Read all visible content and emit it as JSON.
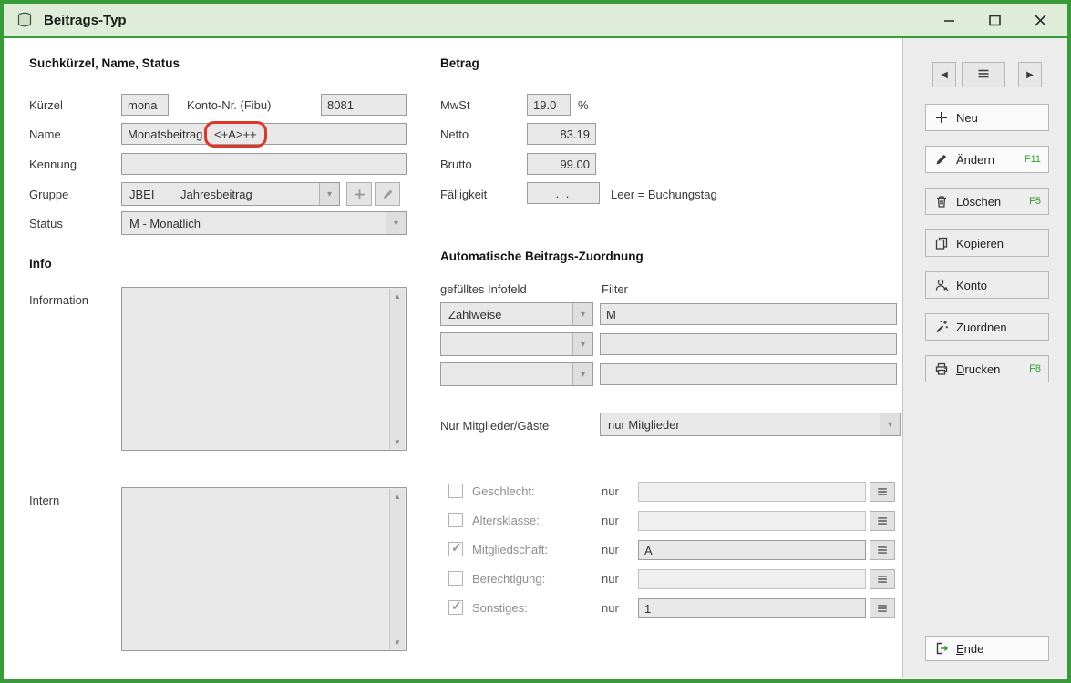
{
  "titlebar": {
    "title": "Beitrags-Typ",
    "icon": "coins-stack",
    "controls": {
      "minimize": "minimize",
      "maximize": "maximize",
      "close": "close"
    }
  },
  "form": {
    "section_title": "Suchkürzel, Name, Status",
    "kuerzel": {
      "label": "Kürzel",
      "value": "mona"
    },
    "konto_nr": {
      "label": "Konto-Nr. (Fibu)",
      "value": "8081"
    },
    "name": {
      "label": "Name",
      "value_prefix": "Monatsbeitrag ",
      "value_highlight": "<+A>++"
    },
    "kennung": {
      "label": "Kennung",
      "value": ""
    },
    "gruppe": {
      "label": "Gruppe",
      "code": "JBEI",
      "text": "Jahresbeitrag"
    },
    "status": {
      "label": "Status",
      "value": "M - Monatlich"
    },
    "info_title": "Info",
    "information": {
      "label": "Information",
      "value": ""
    },
    "intern": {
      "label": "Intern",
      "value": ""
    }
  },
  "betrag": {
    "section_title": "Betrag",
    "mwst": {
      "label": "MwSt",
      "value": "19.0",
      "unit": "%"
    },
    "netto": {
      "label": "Netto",
      "value": "83.19"
    },
    "brutto": {
      "label": "Brutto",
      "value": "99.00"
    },
    "faelligkeit": {
      "label": "Fälligkeit",
      "value": ". .",
      "hint": "Leer = Buchungstag"
    }
  },
  "zuordnung": {
    "section_title": "Automatische Beitrags-Zuordnung",
    "col_infofeld": "gefülltes Infofeld",
    "col_filter": "Filter",
    "rows": [
      {
        "field": "Zahlweise",
        "filter": "M"
      },
      {
        "field": "",
        "filter": ""
      },
      {
        "field": "",
        "filter": ""
      }
    ],
    "mitglieder": {
      "label": "Nur Mitglieder/Gäste",
      "value": "nur Mitglieder"
    },
    "criteria": [
      {
        "checked": false,
        "label": "Geschlecht:",
        "nur": "nur",
        "value": ""
      },
      {
        "checked": false,
        "label": "Altersklasse:",
        "nur": "nur",
        "value": ""
      },
      {
        "checked": true,
        "label": "Mitgliedschaft:",
        "nur": "nur",
        "value": "A"
      },
      {
        "checked": false,
        "label": "Berechtigung:",
        "nur": "nur",
        "value": ""
      },
      {
        "checked": true,
        "label": "Sonstiges:",
        "nur": "nur",
        "value": "1"
      }
    ]
  },
  "sidebar": {
    "nav": {
      "prev": "previous-record",
      "menu": "record-list",
      "next": "next-record"
    },
    "buttons": [
      {
        "label": "Neu",
        "icon": "plus",
        "shortcut": ""
      },
      {
        "label": "Ändern",
        "icon": "pencil",
        "shortcut": "F11"
      },
      {
        "label": "Löschen",
        "icon": "trash",
        "shortcut": "F5"
      },
      {
        "label": "Kopieren",
        "icon": "copy",
        "shortcut": ""
      },
      {
        "label": "Konto",
        "icon": "user",
        "shortcut": ""
      },
      {
        "label": "Zuordnen",
        "icon": "wand",
        "shortcut": ""
      },
      {
        "label": "Drucken",
        "icon": "printer",
        "shortcut": "F8",
        "label_u": "D",
        "label_rest": "rucken"
      }
    ],
    "ende": {
      "icon": "exit",
      "label_u": "E",
      "label_rest": "nde"
    }
  },
  "annotation": {
    "color": "#e0352b"
  },
  "colors": {
    "accent_green": "#379b37",
    "shortcut_green": "#2f9e2f"
  }
}
